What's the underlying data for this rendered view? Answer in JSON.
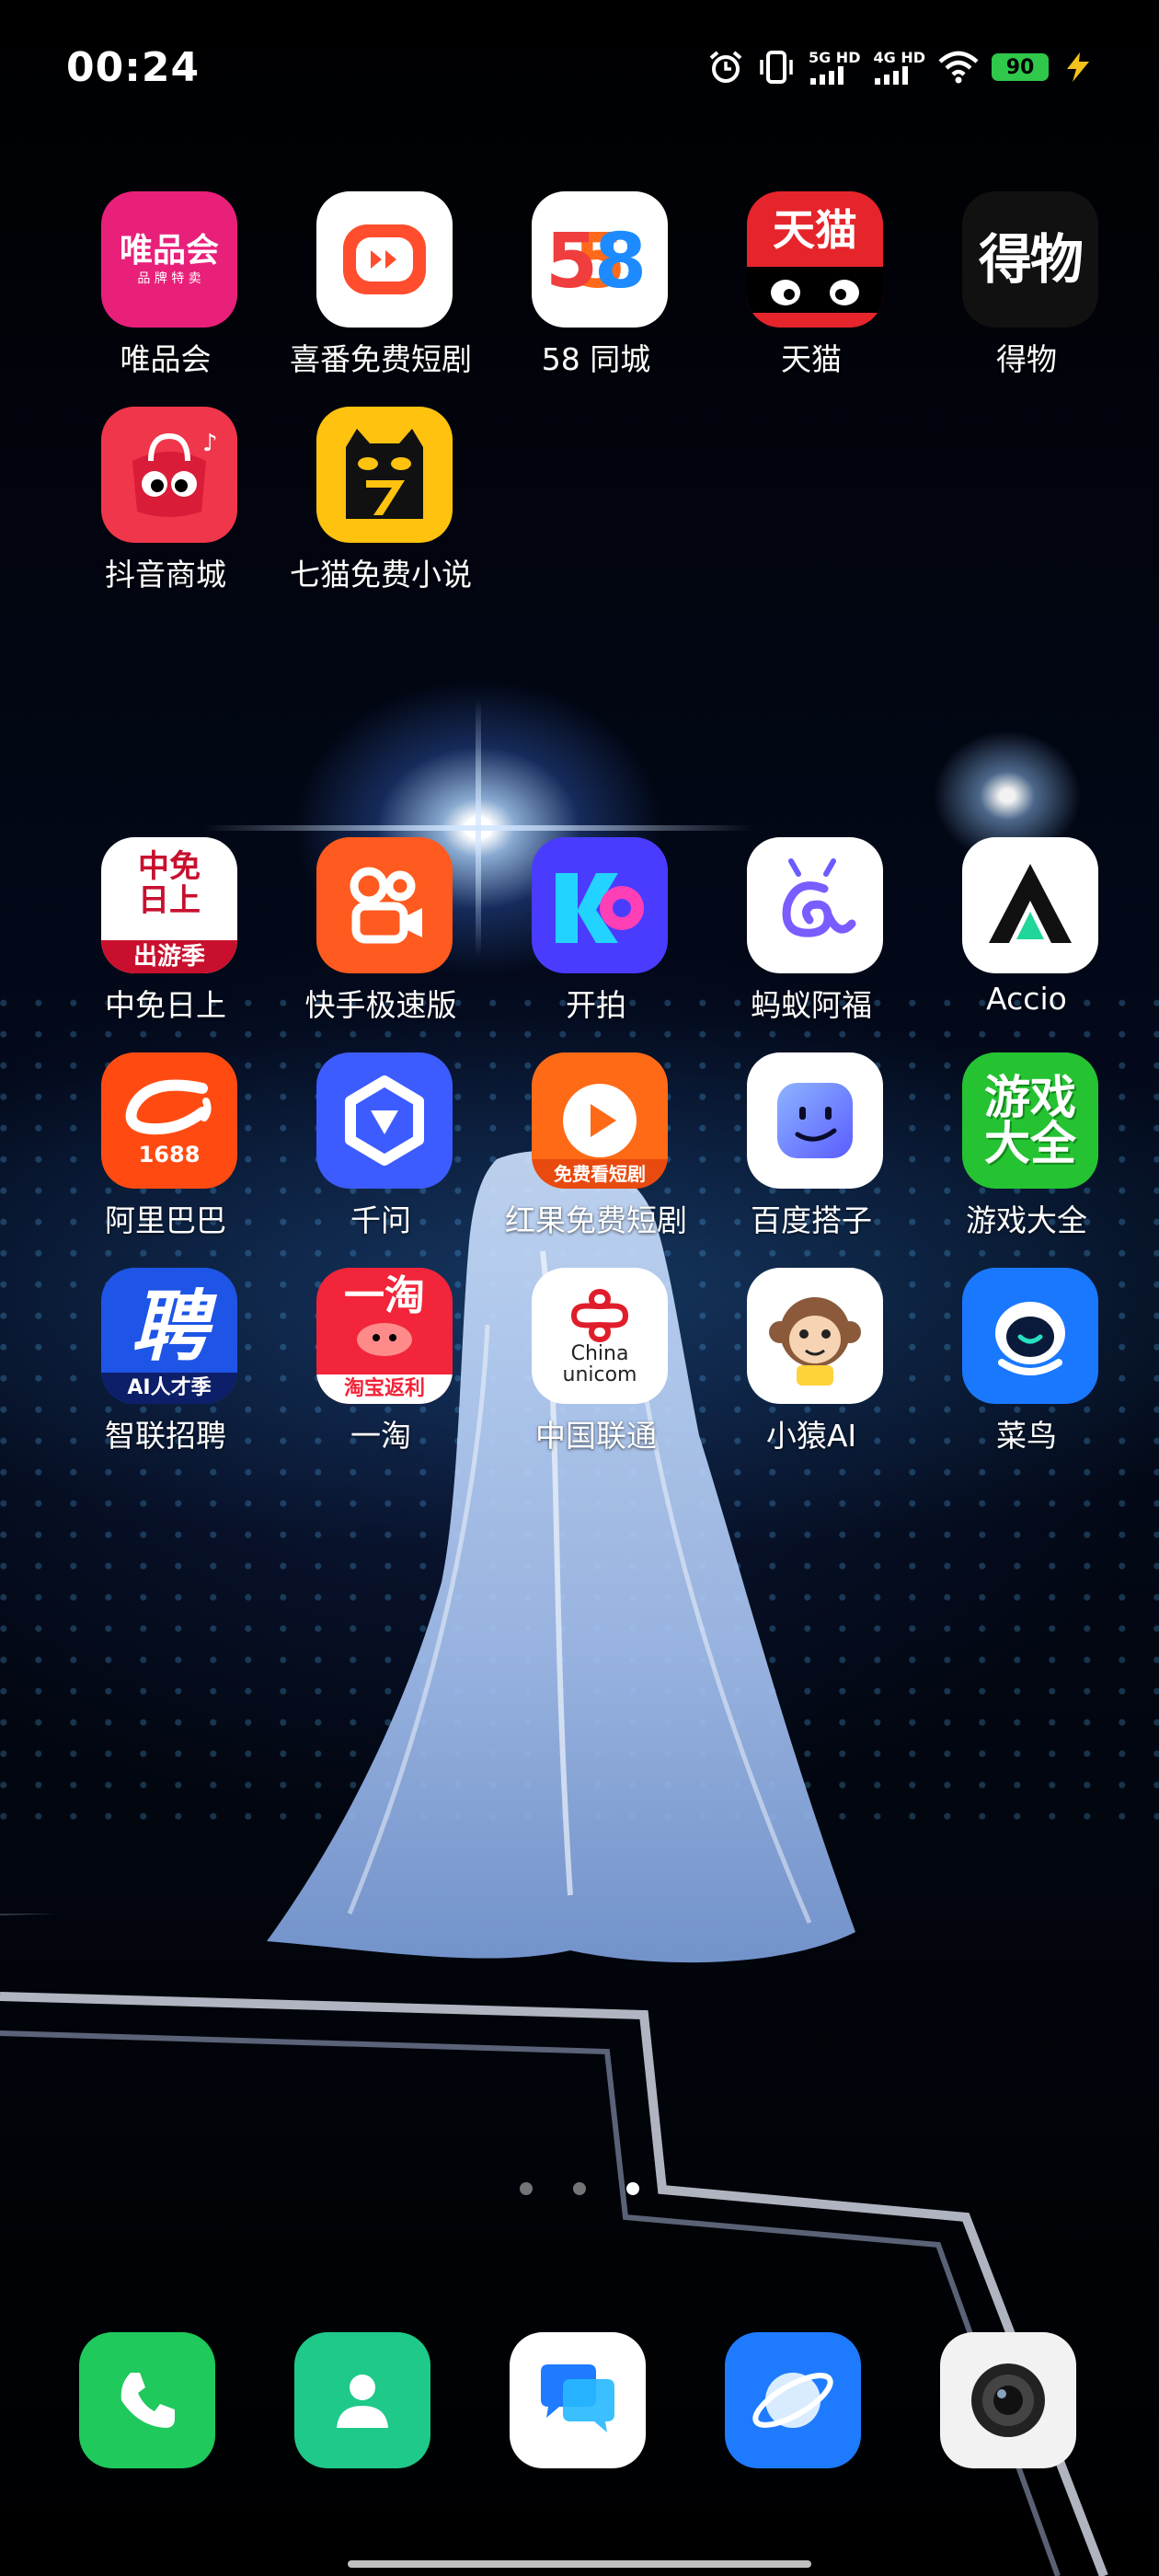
{
  "status_bar": {
    "time": "00:24",
    "network_1": "5G HD",
    "network_2": "4G HD",
    "battery": "90"
  },
  "apps": {
    "vip": {
      "label": "唯品会",
      "icon_title": "唯品会",
      "icon_sub": "品 牌 特 卖"
    },
    "xifan": {
      "label": "喜番免费短剧"
    },
    "tongcheng": {
      "label": "58 同城",
      "icon_text": "58"
    },
    "tmall": {
      "label": "天猫",
      "icon_text": "天猫"
    },
    "dewu": {
      "label": "得物",
      "icon_text": "得物"
    },
    "douyin_mall": {
      "label": "抖音商城"
    },
    "qimao": {
      "label": "七猫免费小说"
    },
    "cdf": {
      "label": "中免日上",
      "icon_text": "中免日上",
      "icon_banner": "出游季"
    },
    "kuaishou": {
      "label": "快手极速版"
    },
    "kaipai": {
      "label": "开拍"
    },
    "antfortune": {
      "label": "蚂蚁阿福"
    },
    "accio": {
      "label": "Accio"
    },
    "alibaba": {
      "label": "阿里巴巴",
      "icon_text": "1688"
    },
    "qianwen": {
      "label": "千问"
    },
    "hongguo": {
      "label": "红果免费短剧",
      "icon_banner": "免费看短剧"
    },
    "baidu_dazi": {
      "label": "百度搭子"
    },
    "game_center": {
      "label": "游戏大全",
      "icon_text": "游戏大全"
    },
    "zhaopin": {
      "label": "智联招聘",
      "icon_text": "聘",
      "icon_banner": "AI人才季"
    },
    "yitao": {
      "label": "一淘",
      "icon_text": "一淘",
      "icon_banner": "淘宝返利"
    },
    "unicom": {
      "label": "中国联通",
      "icon_text_1": "China",
      "icon_text_2": "unicom"
    },
    "yuanfudao": {
      "label": "小猿AI"
    },
    "cainiao": {
      "label": "菜鸟"
    }
  },
  "colors": {
    "vip": "#e8207a",
    "xifan": "#ff4d2e",
    "tmall": "#e5252b",
    "dewu": "#111111",
    "douyin_mall": "#f0364a",
    "qimao": "#ffc20e",
    "kuaishou": "#ff5a1f",
    "kaipai": "#4a3cff",
    "accio": "#ffffff",
    "alibaba": "#ff4b12",
    "qianwen": "#3d5cff",
    "hongguo": "#ff6a16",
    "game_center": "#25c332",
    "zhaopin": "#1e55e6",
    "yitao": "#f2253a",
    "cainiao": "#1a78ff",
    "phone": "#1fc95c",
    "contacts": "#1fc98a",
    "messages": "#ffffff",
    "browser": "#1e7bff",
    "camera": "#f2f2f2",
    "battery": "#2fc84a"
  },
  "page_indicator": {
    "count": 3,
    "active_index": 2
  },
  "dock": [
    "phone-icon",
    "contacts-icon",
    "messages-icon",
    "browser-icon",
    "camera-icon"
  ]
}
